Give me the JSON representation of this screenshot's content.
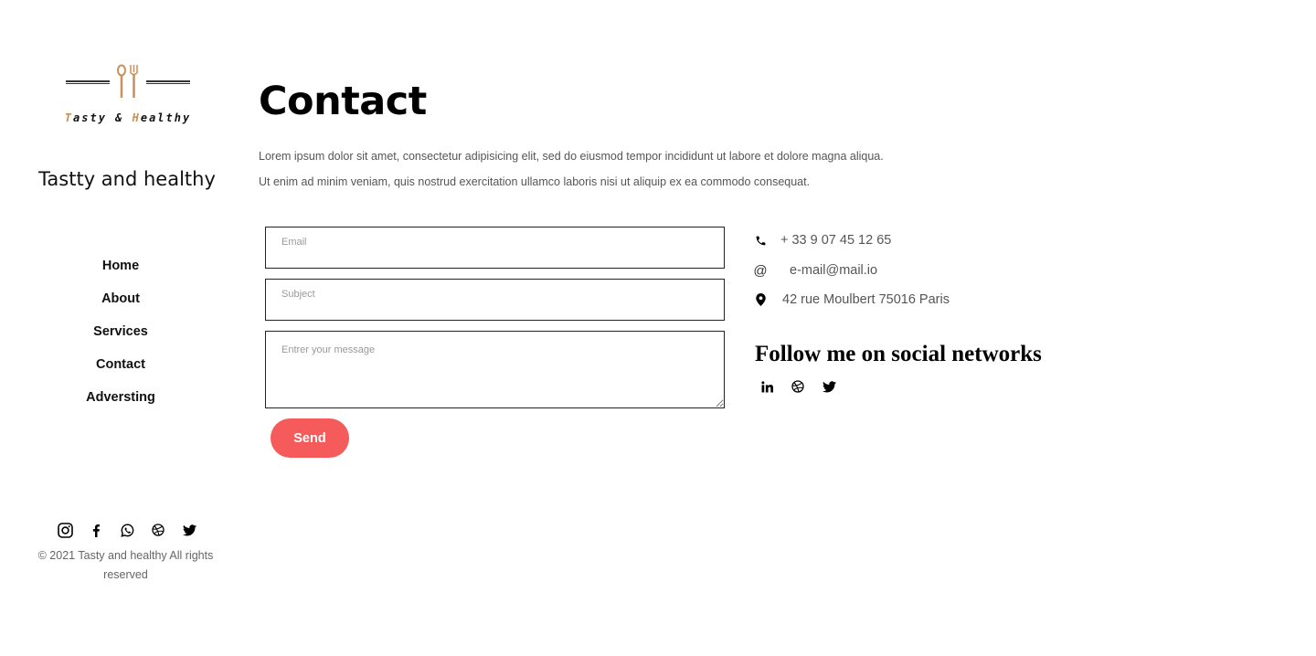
{
  "sidebar": {
    "logo": {
      "brand_part1": "T",
      "brand_part2": "asty & ",
      "brand_part3": "H",
      "brand_part4": "ealthy",
      "icon": "cutlery-icon"
    },
    "site_name": "Tastty and healthy",
    "nav": [
      {
        "label": "Home"
      },
      {
        "label": "About"
      },
      {
        "label": "Services"
      },
      {
        "label": "Contact"
      },
      {
        "label": "Adversting"
      }
    ],
    "social_icons": [
      "instagram-icon",
      "facebook-icon",
      "whatsapp-icon",
      "dribbble-icon",
      "twitter-icon"
    ],
    "copyright": "© 2021 Tasty and healthy All rights reserved"
  },
  "main": {
    "title": "Contact",
    "intro_line1": "Lorem ipsum dolor sit amet, consectetur adipisicing elit, sed do eiusmod tempor incididunt ut labore et dolore magna aliqua.",
    "intro_line2": "Ut enim ad minim veniam, quis nostrud exercitation ullamco laboris nisi ut aliquip ex ea commodo consequat.",
    "form": {
      "email_placeholder": "Email",
      "email_value": "",
      "subject_placeholder": "Subject",
      "subject_value": "",
      "message_placeholder": "Entrer your message",
      "message_value": "",
      "send_label": "Send"
    },
    "contact_info": {
      "phone": "+ 33 9 07 45 12 65",
      "email": "e-mail@mail.io",
      "address": "42 rue Moulbert 75016 Paris"
    },
    "follow": {
      "title": "Follow me on social networks",
      "icons": [
        "linkedin-icon",
        "dribbble-icon",
        "twitter-icon"
      ]
    }
  },
  "colors": {
    "accent_button": "#f65b5b",
    "logo_accent": "#c8905a",
    "body_text": "#555555"
  }
}
